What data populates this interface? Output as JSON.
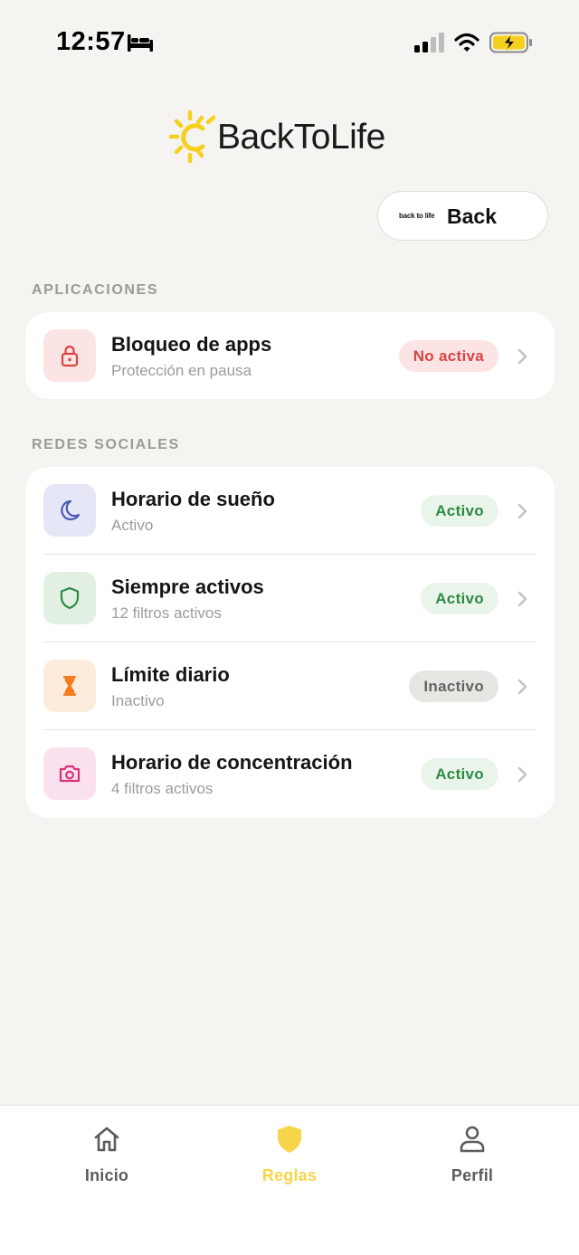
{
  "status_bar": {
    "time": "12:57",
    "icons": [
      "bed-icon",
      "signal-icon",
      "wifi-icon",
      "battery-charging-icon"
    ],
    "battery_color": "#F6D01E"
  },
  "logo": {
    "text": "BackToLife",
    "sun_color": "#F6D01E"
  },
  "back_chip": {
    "mini_label": "back to life",
    "label": "Back"
  },
  "sections": {
    "apps": {
      "title": "APLICACIONES",
      "rows": [
        {
          "title": "Bloqueo de apps",
          "subtitle": "Protección en pausa",
          "badge": "No activa",
          "icon": "lock-icon",
          "icon_color": "#D94444",
          "icon_bg": "#FCE4E4"
        }
      ]
    },
    "social": {
      "title": "REDES SOCIALES",
      "rows": [
        {
          "title": "Horario de sueño",
          "subtitle": "Activo",
          "badge": "Activo",
          "icon": "moon-icon",
          "icon_color": "#4F57B8",
          "icon_bg": "#E6E7F6"
        },
        {
          "title": "Siempre activos",
          "subtitle": "12 filtros activos",
          "badge": "Activo",
          "icon": "shield-icon",
          "icon_color": "#2F8A45",
          "icon_bg": "#E2EFE3"
        },
        {
          "title": "Límite diario",
          "subtitle": "Inactivo",
          "badge": "Inactivo",
          "icon": "hourglass-icon",
          "icon_color": "#F27C1E",
          "icon_bg": "#FDEBDC"
        },
        {
          "title": "Horario de concentración",
          "subtitle": "4 filtros activos",
          "badge": "Activo",
          "icon": "camera-icon",
          "icon_color": "#D6337A",
          "icon_bg": "#FBE1EE"
        }
      ]
    }
  },
  "tab_bar": {
    "tabs": [
      {
        "label": "Inicio",
        "icon": "home-icon",
        "active": false
      },
      {
        "label": "Reglas",
        "icon": "shield-icon",
        "active": true
      },
      {
        "label": "Perfil",
        "icon": "person-icon",
        "active": false
      }
    ],
    "active_color": "#F6D54A",
    "inactive_color": "#5C5B58"
  }
}
